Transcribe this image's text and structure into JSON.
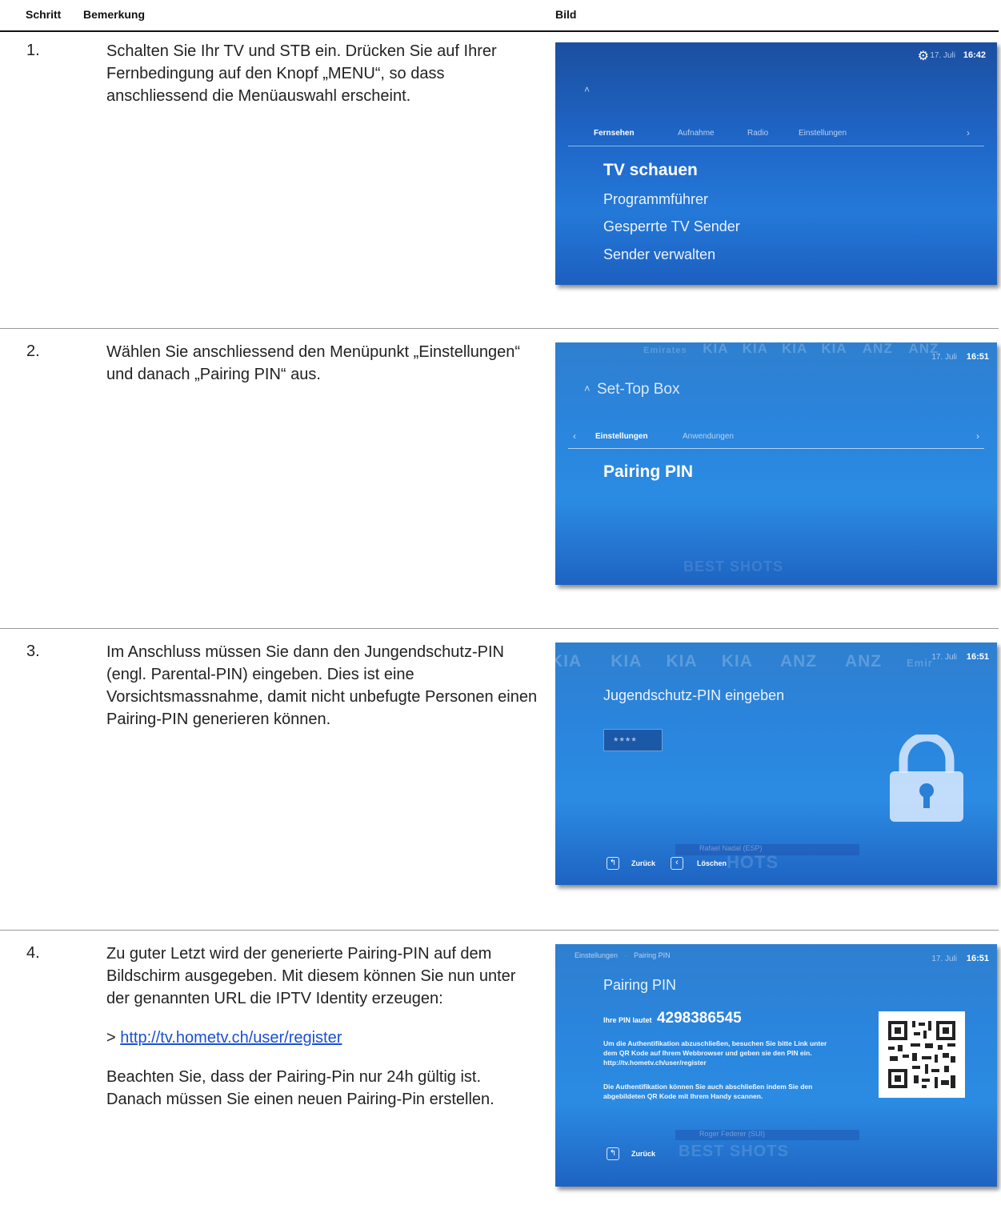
{
  "header": {
    "col_step": "Schritt",
    "col_remark": "Bemerkung",
    "col_image": "Bild"
  },
  "rows": [
    {
      "step": "1.",
      "text": "Schalten Sie Ihr TV und STB ein. Drücken Sie auf Ihrer Fernbedingung auf den Knopf „MENU“, so dass anschliessend die Menüauswahl erscheint."
    },
    {
      "step": "2.",
      "text": "Wählen Sie anschliessend den Menüpunkt „Einstellungen“ und danach „Pairing PIN“ aus."
    },
    {
      "step": "3.",
      "text": "Im Anschluss müssen Sie dann den Jungendschutz-PIN (engl. Parental-PIN) eingeben. Dies ist eine Vorsichtsmassnahme, damit nicht unbefugte Personen einen Pairing-PIN generieren können."
    },
    {
      "step": "4.",
      "text": "Zu guter Letzt wird der generierte Pairing-PIN auf dem Bildschirm ausgegeben. Mit diesem können Sie nun unter der genannten URL die IPTV Identity erzeugen:",
      "link_prefix": "> ",
      "link": "http://tv.hometv.ch/user/register",
      "note": "Beachten Sie, dass der Pairing-Pin nur 24h gültig ist. Danach müssen Sie einen neuen Pairing-Pin erstellen."
    }
  ],
  "shot1": {
    "date": "17. Juli",
    "time": "16:42",
    "tabs": [
      "Fernsehen",
      "Aufnahme",
      "Radio",
      "Einstellungen"
    ],
    "items": [
      "TV schauen",
      "Programmführer",
      "Gesperrte TV Sender",
      "Sender verwalten"
    ]
  },
  "shot2": {
    "date": "17. Juli",
    "time": "16:51",
    "ads": [
      "Emirates",
      "KIA",
      "KIA",
      "KIA",
      "KIA",
      "ANZ",
      "ANZ"
    ],
    "title": "Set-Top Box",
    "tabs": [
      "Einstellungen",
      "Anwendungen"
    ],
    "item": "Pairing PIN",
    "overlay": "BEST SHOTS"
  },
  "shot3": {
    "date": "17. Juli",
    "time": "16:51",
    "ads": [
      "KIA",
      "KIA",
      "KIA",
      "KIA",
      "ANZ",
      "ANZ",
      "Emir"
    ],
    "title": "Jugendschutz-PIN eingeben",
    "pin_mask": "****",
    "player": "Rafael Nadal (ESP)",
    "back": "Zurück",
    "delete": "Löschen",
    "overlay": "HOTS"
  },
  "shot4": {
    "date": "17. Juli",
    "time": "16:51",
    "breadcrumb": [
      "Einstellungen",
      "Pairing PIN"
    ],
    "title": "Pairing PIN",
    "pin_label": "Ihre PIN lautet",
    "pin": "4298386545",
    "p1": "Um die Authentifikation abzuschließen, besuchen Sie bitte Link unter dem QR Kode auf Ihrem Webbrowser und geben sie den PIN ein. http://tv.hometv.ch/user/register",
    "p2": "Die Authentifikation können Sie auch abschließen indem Sie den abgebildeten QR Kode mit Ihrem Handy scannen.",
    "player": "Roger Federer (SUI)",
    "back": "Zurück",
    "overlay": "BEST SHOTS"
  }
}
